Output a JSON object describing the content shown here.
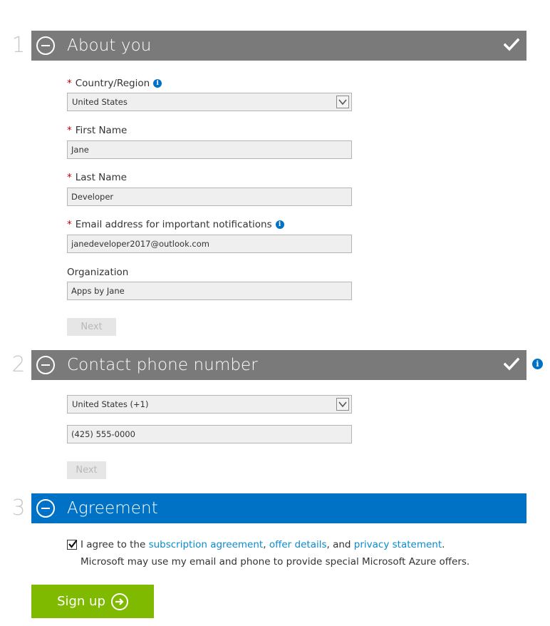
{
  "sections": [
    {
      "number": "1",
      "title": "About you",
      "completed": true
    },
    {
      "number": "2",
      "title": "Contact phone number",
      "completed": true
    },
    {
      "number": "3",
      "title": "Agreement",
      "completed": false
    }
  ],
  "about": {
    "country_label": "Country/Region",
    "country_value": "United States",
    "first_name_label": "First Name",
    "first_name_value": "Jane",
    "last_name_label": "Last Name",
    "last_name_value": "Developer",
    "email_label": "Email address for important notifications",
    "email_value": "janedeveloper2017@outlook.com",
    "org_label": "Organization",
    "org_value": "Apps by Jane",
    "next_label": "Next",
    "required_marker": "*"
  },
  "phone": {
    "country_code_value": "United States (+1)",
    "phone_value": "(425) 555-0000",
    "next_label": "Next"
  },
  "agreement": {
    "prefix": "I agree to the ",
    "subscription_link": "subscription agreement",
    "sep1": ", ",
    "offer_link": "offer details",
    "sep2": ", and ",
    "privacy_link": "privacy statement",
    "suffix": ".",
    "checked": true,
    "offer_text": "Microsoft may use my email and phone to provide special Microsoft Azure offers."
  },
  "signup": {
    "label": "Sign up"
  },
  "colors": {
    "section_bar": "#7a7a7a",
    "active_bar": "#0072c6",
    "signup": "#7fba00",
    "link": "#0a8ccc",
    "required": "#c00000"
  },
  "icons": [
    "collapse-icon",
    "check-icon",
    "info-icon",
    "chevron-down-icon",
    "arrow-right-icon"
  ]
}
